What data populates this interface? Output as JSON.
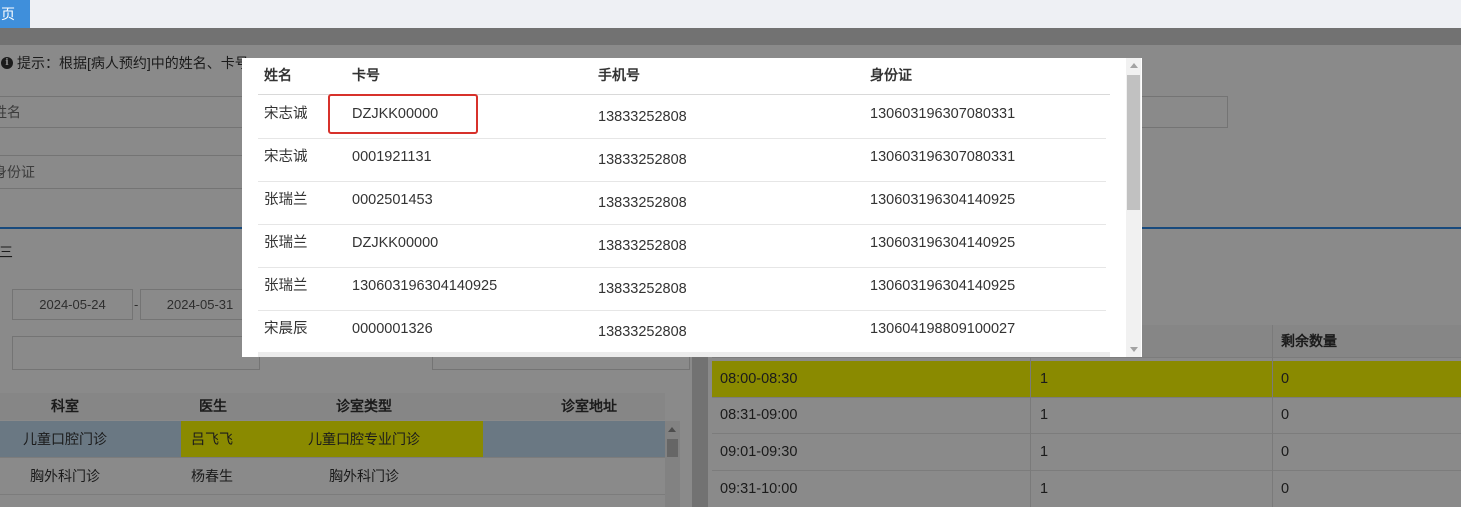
{
  "colors": {
    "tab_blue": "#3f8fdb",
    "highlight_yellow": "#ffff00",
    "selected_blue": "#c4def3",
    "section_line_blue": "#2d8ae8",
    "annotation_red": "#d7312b"
  },
  "tab_bar": {
    "home_tab_label": "页"
  },
  "search_panel": {
    "tip_icon": "info-circle-icon",
    "tip_text": "提示：根据[病人预约]中的姓名、卡号",
    "name_placeholder": "姓名",
    "id_card_placeholder": "身份证"
  },
  "schedule_panel": {
    "title": "三",
    "date_start": "2024-05-24",
    "date_separator": "-",
    "date_end": "2024-05-31"
  },
  "clinic_table": {
    "headers": {
      "department": "科室",
      "doctor": "医生",
      "room_type": "诊室类型",
      "room_address": "诊室地址"
    },
    "rows": [
      {
        "department": "儿童口腔门诊",
        "doctor": "吕飞飞",
        "room_type": "儿童口腔专业门诊",
        "selected": true,
        "doctor_highlighted": true,
        "room_type_highlighted": true
      },
      {
        "department": "胸外科门诊",
        "doctor": "杨春生",
        "room_type": "胸外科门诊",
        "selected": false,
        "doctor_highlighted": false,
        "room_type_highlighted": false
      }
    ]
  },
  "slot_table": {
    "headers": {
      "remaining": "剩余数量"
    },
    "rows": [
      {
        "time": "08:00-08:30",
        "count": "1",
        "remaining": "0",
        "highlighted": true
      },
      {
        "time": "08:31-09:00",
        "count": "1",
        "remaining": "0",
        "highlighted": false
      },
      {
        "time": "09:01-09:30",
        "count": "1",
        "remaining": "0",
        "highlighted": false
      },
      {
        "time": "09:31-10:00",
        "count": "1",
        "remaining": "0",
        "highlighted": false
      }
    ]
  },
  "patient_modal": {
    "headers": {
      "name": "姓名",
      "card_no": "卡号",
      "phone": "手机号",
      "id_card": "身份证"
    },
    "rows": [
      {
        "name": "宋志诚",
        "card_no": "DZJKK00000",
        "phone": "13833252808",
        "id_card": "130603196307080331",
        "annotated": true
      },
      {
        "name": "宋志诚",
        "card_no": "0001921131",
        "phone": "13833252808",
        "id_card": "130603196307080331",
        "annotated": false
      },
      {
        "name": "张瑞兰",
        "card_no": "0002501453",
        "phone": "13833252808",
        "id_card": "130603196304140925",
        "annotated": false
      },
      {
        "name": "张瑞兰",
        "card_no": "DZJKK00000",
        "phone": "13833252808",
        "id_card": "130603196304140925",
        "annotated": false
      },
      {
        "name": "张瑞兰",
        "card_no": "130603196304140925",
        "phone": "13833252808",
        "id_card": "130603196304140925",
        "annotated": false
      },
      {
        "name": "宋晨辰",
        "card_no": "0000001326",
        "phone": "13833252808",
        "id_card": "130604198809100027",
        "annotated": false
      }
    ]
  }
}
